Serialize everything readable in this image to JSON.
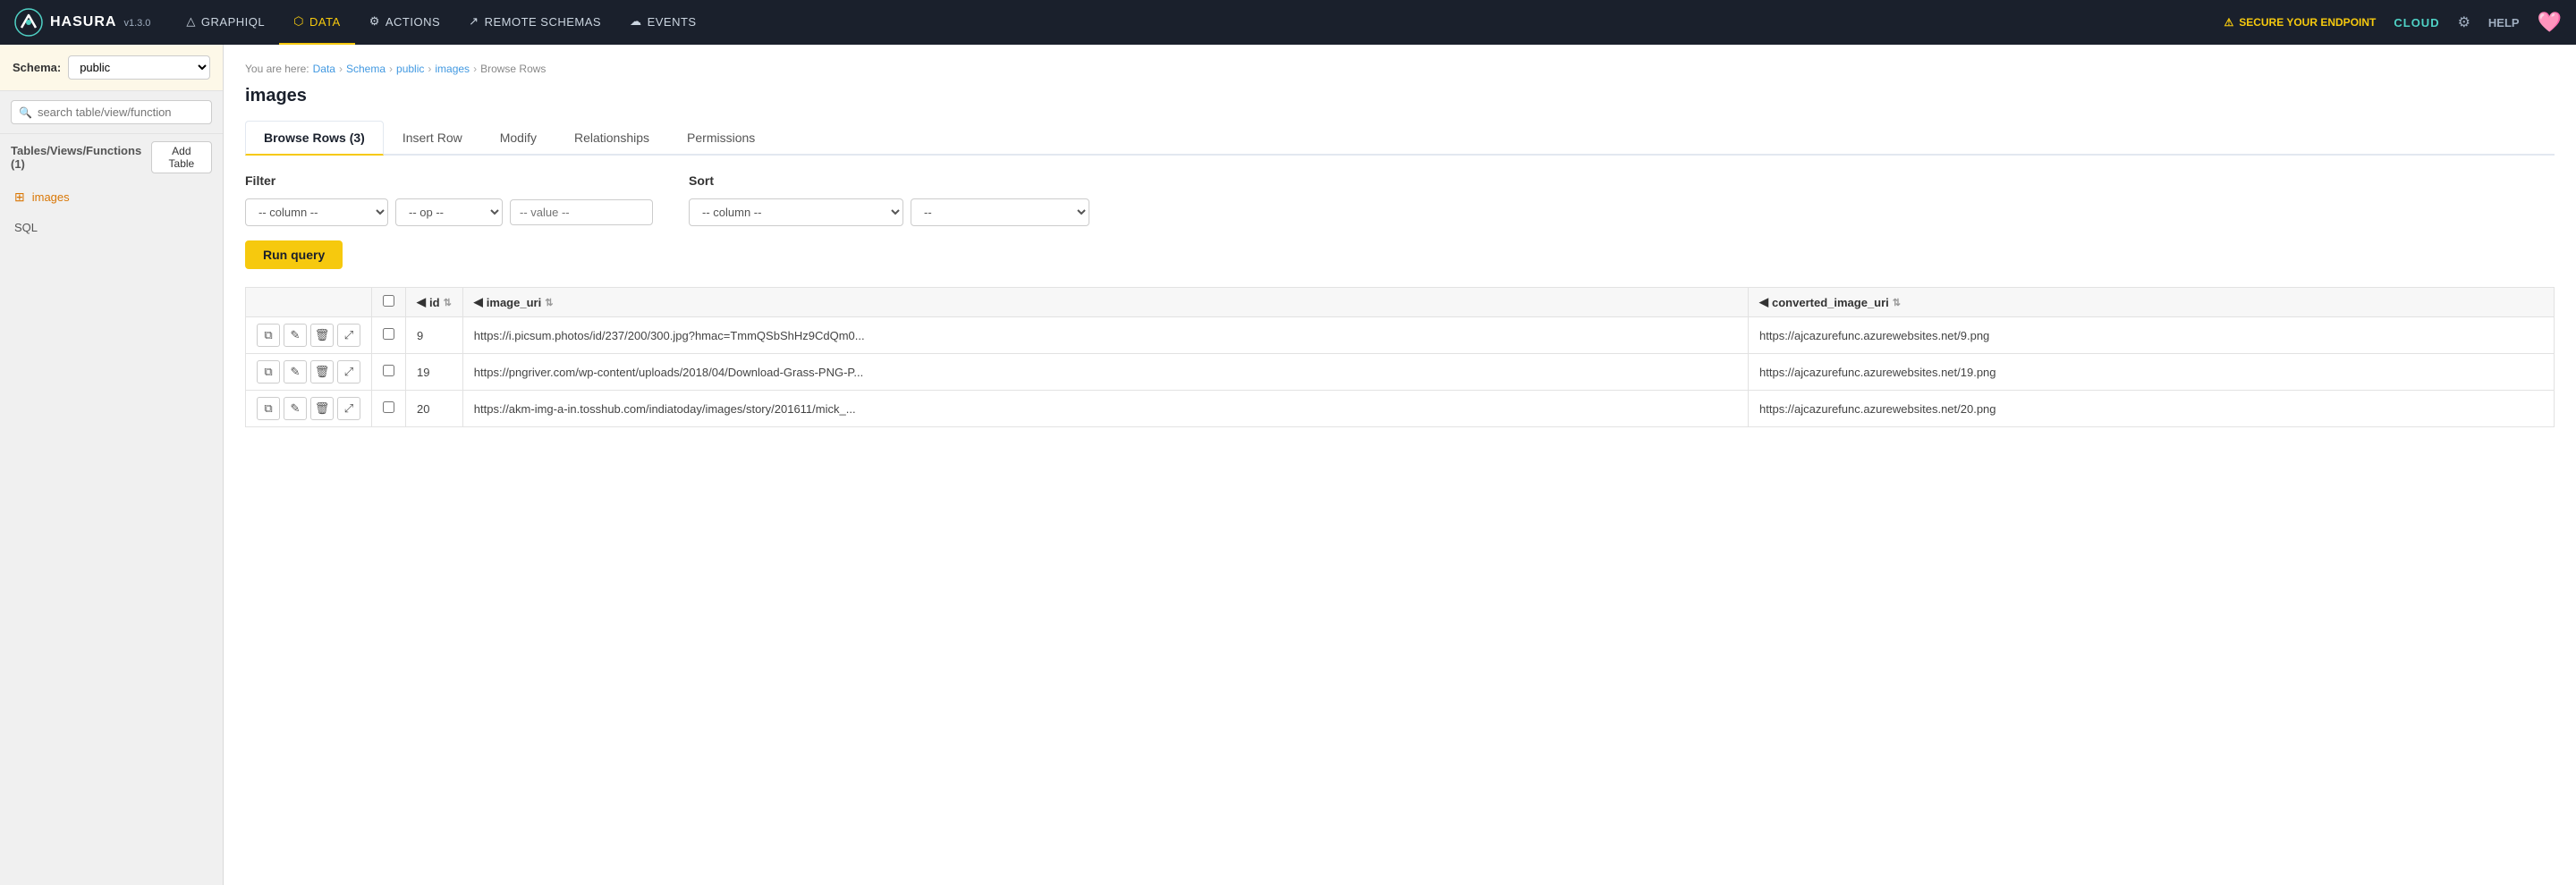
{
  "app": {
    "logo_text": "HASURA",
    "version": "v1.3.0"
  },
  "topnav": {
    "items": [
      {
        "id": "graphiql",
        "label": "GRAPHIQL",
        "icon": "△",
        "active": false
      },
      {
        "id": "data",
        "label": "DATA",
        "icon": "⬡",
        "active": true
      },
      {
        "id": "actions",
        "label": "ACTIONS",
        "icon": "⚙",
        "active": false
      },
      {
        "id": "remote-schemas",
        "label": "REMOTE SCHEMAS",
        "icon": "↗",
        "active": false
      },
      {
        "id": "events",
        "label": "EVENTS",
        "icon": "☁",
        "active": false
      }
    ],
    "secure_endpoint": "SECURE YOUR ENDPOINT",
    "cloud": "CLOUD",
    "help": "HELP"
  },
  "sidebar": {
    "schema_label": "Schema:",
    "schema_value": "public",
    "search_placeholder": "search table/view/function",
    "tables_header": "Tables/Views/Functions (1)",
    "add_table_label": "Add Table",
    "tables": [
      {
        "name": "images"
      }
    ],
    "sql_label": "SQL"
  },
  "breadcrumb": {
    "items": [
      {
        "label": "Data",
        "link": true
      },
      {
        "label": "Schema",
        "link": true
      },
      {
        "label": "public",
        "link": true
      },
      {
        "label": "images",
        "link": true
      },
      {
        "label": "Browse Rows",
        "link": false
      }
    ]
  },
  "page_title": "images",
  "tabs": [
    {
      "id": "browse",
      "label": "Browse Rows (3)",
      "active": true
    },
    {
      "id": "insert",
      "label": "Insert Row",
      "active": false
    },
    {
      "id": "modify",
      "label": "Modify",
      "active": false
    },
    {
      "id": "relationships",
      "label": "Relationships",
      "active": false
    },
    {
      "id": "permissions",
      "label": "Permissions",
      "active": false
    }
  ],
  "filter": {
    "label": "Filter",
    "column_placeholder": "-- column --",
    "op_placeholder": "-- op --",
    "value_placeholder": "-- value --"
  },
  "sort": {
    "label": "Sort",
    "column_placeholder": "-- column --",
    "dir_placeholder": "--"
  },
  "run_query_label": "Run query",
  "table": {
    "columns": [
      {
        "id": "actions",
        "label": ""
      },
      {
        "id": "cb",
        "label": ""
      },
      {
        "id": "id",
        "label": "id",
        "sortable": true
      },
      {
        "id": "image_uri",
        "label": "image_uri",
        "sortable": true
      },
      {
        "id": "converted_image_uri",
        "label": "converted_image_uri",
        "sortable": true
      }
    ],
    "rows": [
      {
        "id": "9",
        "image_uri": "https://i.picsum.photos/id/237/200/300.jpg?hmac=TmmQSbShHz9CdQm0...",
        "converted_image_uri": "https://ajcazurefunc.azurewebsites.net/9.png"
      },
      {
        "id": "19",
        "image_uri": "https://pngriver.com/wp-content/uploads/2018/04/Download-Grass-PNG-P...",
        "converted_image_uri": "https://ajcazurefunc.azurewebsites.net/19.png"
      },
      {
        "id": "20",
        "image_uri": "https://akm-img-a-in.tosshub.com/indiatoday/images/story/201611/mick_...",
        "converted_image_uri": "https://ajcazurefunc.azurewebsites.net/20.png"
      }
    ]
  },
  "colors": {
    "accent": "#f6c90e",
    "link": "#4299e1",
    "table_name": "#d97706",
    "cloud": "#4fd1c5"
  }
}
